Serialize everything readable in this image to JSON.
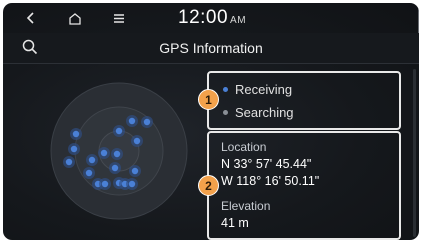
{
  "statusbar": {
    "back_icon": "chevron-left-icon",
    "home_icon": "home-icon",
    "menu_icon": "menu-icon",
    "clock": "12:00",
    "ampm": "AM"
  },
  "header": {
    "title": "GPS Information",
    "search_icon": "search-icon"
  },
  "legend": {
    "receiving": "Receiving",
    "searching": "Searching",
    "receiving_color": "#4a80d6",
    "searching_color": "#8a8f96"
  },
  "info": {
    "location_label": "Location",
    "latitude": "N 33° 57' 45.44\"",
    "longitude": "W 118° 16' 50.11\"",
    "elevation_label": "Elevation",
    "elevation": "41 m"
  },
  "callouts": [
    "1",
    "2"
  ],
  "colors": {
    "accent_callout": "#f2a14b",
    "satellite": "#4a80d6",
    "background": "#15181c"
  }
}
